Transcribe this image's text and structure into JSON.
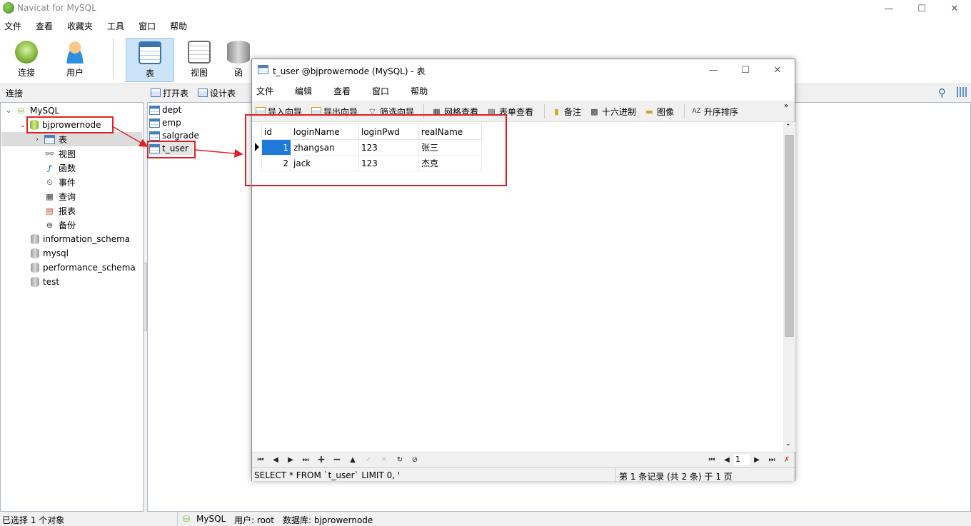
{
  "app": {
    "title": "Navicat for MySQL"
  },
  "window_controls": {
    "minimize": "—",
    "maximize": "☐",
    "close": "✕"
  },
  "menu": [
    "文件",
    "查看",
    "收藏夹",
    "工具",
    "窗口",
    "帮助"
  ],
  "toolbar": {
    "buttons": [
      {
        "label": "连接",
        "icon": "connect-icon"
      },
      {
        "label": "用户",
        "icon": "user-icon"
      },
      {
        "label": "表",
        "icon": "table-icon"
      },
      {
        "label": "视图",
        "icon": "view-icon"
      },
      {
        "label": "函",
        "icon": "function-icon"
      }
    ]
  },
  "subbar": {
    "connection_label": "连接",
    "open_table": "打开表",
    "design_table": "设计表"
  },
  "tree": {
    "root": "MySQL",
    "databases": [
      "bjprowernode",
      "information_schema",
      "mysql",
      "performance_schema",
      "test"
    ],
    "children": [
      "表",
      "视图",
      "函数",
      "事件",
      "查询",
      "报表",
      "备份"
    ]
  },
  "objects": [
    "dept",
    "emp",
    "salgrade",
    "t_user"
  ],
  "statusbar": {
    "selection": "已选择 1 个对象",
    "connection": "MySQL",
    "user": "用户: root",
    "database": "数据库: bjprowernode"
  },
  "subwindow": {
    "title": "t_user @bjprowernode (MySQL) - 表",
    "menu": [
      "文件",
      "编辑",
      "查看",
      "窗口",
      "帮助"
    ],
    "toolbar": [
      "导入向导",
      "导出向导",
      "筛选向导",
      "网格查看",
      "表单查看",
      "备注",
      "十六进制",
      "图像",
      "升序排序"
    ],
    "columns": [
      "id",
      "loginName",
      "loginPwd",
      "realName"
    ],
    "rows": [
      [
        "1",
        "zhangsan",
        "123",
        "张三"
      ],
      [
        "2",
        "jack",
        "123",
        "杰克"
      ]
    ],
    "sql": "SELECT * FROM `t_user` LIMIT 0, '",
    "record_info": "第 1 条记录 (共 2 条) 于 1 页",
    "page_number": "1"
  },
  "colors": {
    "annotation_red": "#e02020",
    "selection_blue": "#1e7ad6",
    "toolbar_active": "#cce4f7"
  }
}
